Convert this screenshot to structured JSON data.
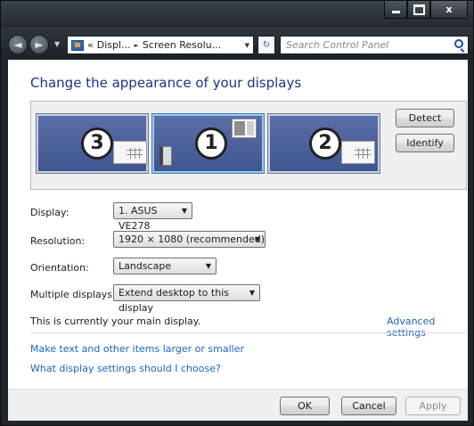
{
  "window": {
    "close_glyph": "x"
  },
  "nav": {
    "back_glyph": "◄",
    "forward_glyph": "►",
    "history_glyph": "▼",
    "breadcrumb_prefix": "«",
    "breadcrumb_1": "Displ...",
    "breadcrumb_sep": "►",
    "breadcrumb_2": "Screen Resolu...",
    "dropdown_glyph": "▼",
    "refresh_glyph": "↻",
    "search_placeholder": "Search Control Panel"
  },
  "main": {
    "heading": "Change the appearance of your displays",
    "monitors": [
      {
        "number": "3",
        "selected": false
      },
      {
        "number": "1",
        "selected": true
      },
      {
        "number": "2",
        "selected": false
      }
    ],
    "detect_label": "Detect",
    "identify_label": "Identify",
    "settings": {
      "display_label": "Display:",
      "display_value": "1. ASUS VE278",
      "resolution_label": "Resolution:",
      "resolution_value": "1920 × 1080 (recommended)",
      "orientation_label": "Orientation:",
      "orientation_value": "Landscape",
      "multiple_label": "Multiple displays:",
      "multiple_value": "Extend desktop to this display"
    },
    "info_text": "This is currently your main display.",
    "advanced_link": "Advanced settings",
    "link_text_size": "Make text and other items larger or smaller",
    "link_which_settings": "What display settings should I choose?"
  },
  "footer": {
    "ok_label": "OK",
    "cancel_label": "Cancel",
    "apply_label": "Apply"
  },
  "colors": {
    "heading": "#1e3287",
    "link": "#1c64bd",
    "monitor_fill": "#4a5f9c",
    "chrome": "#23292f"
  }
}
